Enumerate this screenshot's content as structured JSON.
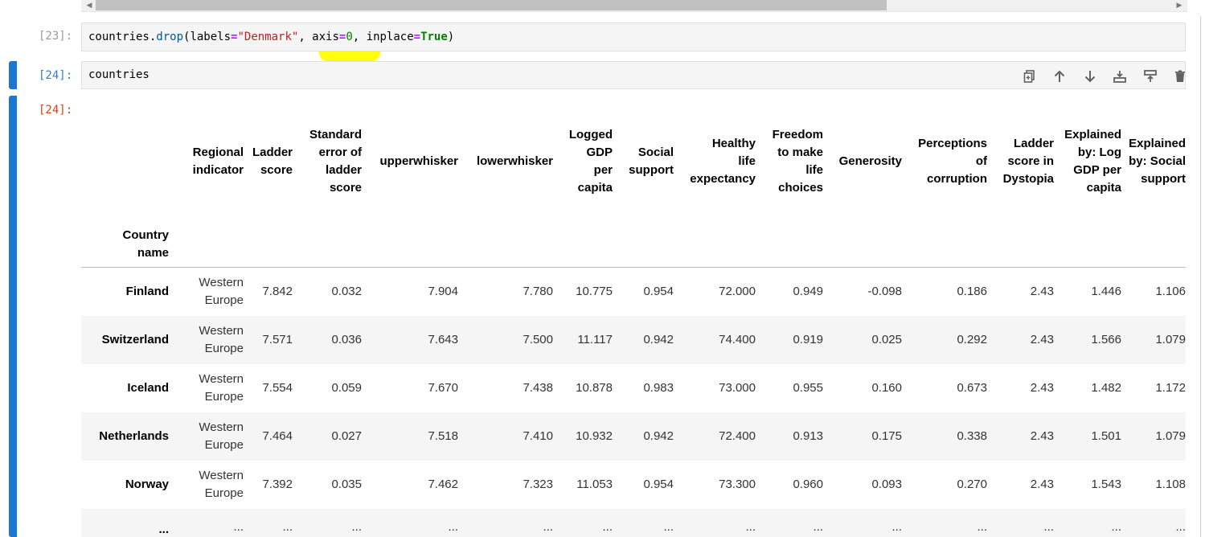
{
  "cells": [
    {
      "prompt": "[23]:",
      "code": [
        {
          "t": "countries.",
          "c": ""
        },
        {
          "t": "drop",
          "c": "c-fn"
        },
        {
          "t": "(labels",
          "c": ""
        },
        {
          "t": "=",
          "c": "c-op"
        },
        {
          "t": "\"Denmark\"",
          "c": "c-str"
        },
        {
          "t": ", axis",
          "c": ""
        },
        {
          "t": "=",
          "c": "c-op"
        },
        {
          "t": "0",
          "c": "c-num"
        },
        {
          "t": ", inplace",
          "c": ""
        },
        {
          "t": "=",
          "c": "c-op"
        },
        {
          "t": "True",
          "c": "c-kw"
        },
        {
          "t": ")",
          "c": ""
        }
      ]
    },
    {
      "prompt": "[24]:",
      "code_text": "countries"
    },
    {
      "prompt": "[24]:"
    }
  ],
  "toolbar_icons": [
    "duplicate-icon",
    "move-up-icon",
    "move-down-icon",
    "insert-below-icon",
    "insert-above-icon",
    "delete-icon"
  ],
  "dataframe": {
    "columns": [
      [
        "Regional",
        "indicator"
      ],
      [
        "Ladder",
        "score"
      ],
      [
        "Standard",
        "error of",
        "ladder",
        "score"
      ],
      [
        "upperwhisker"
      ],
      [
        "lowerwhisker"
      ],
      [
        "Logged",
        "GDP",
        "per",
        "capita"
      ],
      [
        "Social",
        "support"
      ],
      [
        "Healthy",
        "life",
        "expectancy"
      ],
      [
        "Freedom",
        "to make",
        "life",
        "choices"
      ],
      [
        "Generosity"
      ],
      [
        "Perceptions",
        "of",
        "corruption"
      ],
      [
        "Ladder",
        "score in",
        "Dystopia"
      ],
      [
        "Explained",
        "by: Log",
        "GDP per",
        "capita"
      ],
      [
        "Explained",
        "by: Social",
        "support"
      ]
    ],
    "index_name": [
      "Country",
      "name"
    ],
    "rows": [
      {
        "name": "Finland",
        "values": [
          [
            "Western",
            "Europe"
          ],
          "7.842",
          "0.032",
          "7.904",
          "7.780",
          "10.775",
          "0.954",
          "72.000",
          "0.949",
          "-0.098",
          "0.186",
          "2.43",
          "1.446",
          "1.106"
        ]
      },
      {
        "name": "Switzerland",
        "values": [
          [
            "Western",
            "Europe"
          ],
          "7.571",
          "0.036",
          "7.643",
          "7.500",
          "11.117",
          "0.942",
          "74.400",
          "0.919",
          "0.025",
          "0.292",
          "2.43",
          "1.566",
          "1.079"
        ]
      },
      {
        "name": "Iceland",
        "values": [
          [
            "Western",
            "Europe"
          ],
          "7.554",
          "0.059",
          "7.670",
          "7.438",
          "10.878",
          "0.983",
          "73.000",
          "0.955",
          "0.160",
          "0.673",
          "2.43",
          "1.482",
          "1.172"
        ]
      },
      {
        "name": "Netherlands",
        "values": [
          [
            "Western",
            "Europe"
          ],
          "7.464",
          "0.027",
          "7.518",
          "7.410",
          "10.932",
          "0.942",
          "72.400",
          "0.913",
          "0.175",
          "0.338",
          "2.43",
          "1.501",
          "1.079"
        ]
      },
      {
        "name": "Norway",
        "values": [
          [
            "Western",
            "Europe"
          ],
          "7.392",
          "0.035",
          "7.462",
          "7.323",
          "11.053",
          "0.954",
          "73.300",
          "0.960",
          "0.093",
          "0.270",
          "2.43",
          "1.543",
          "1.108"
        ]
      }
    ],
    "ellipsis": "..."
  }
}
